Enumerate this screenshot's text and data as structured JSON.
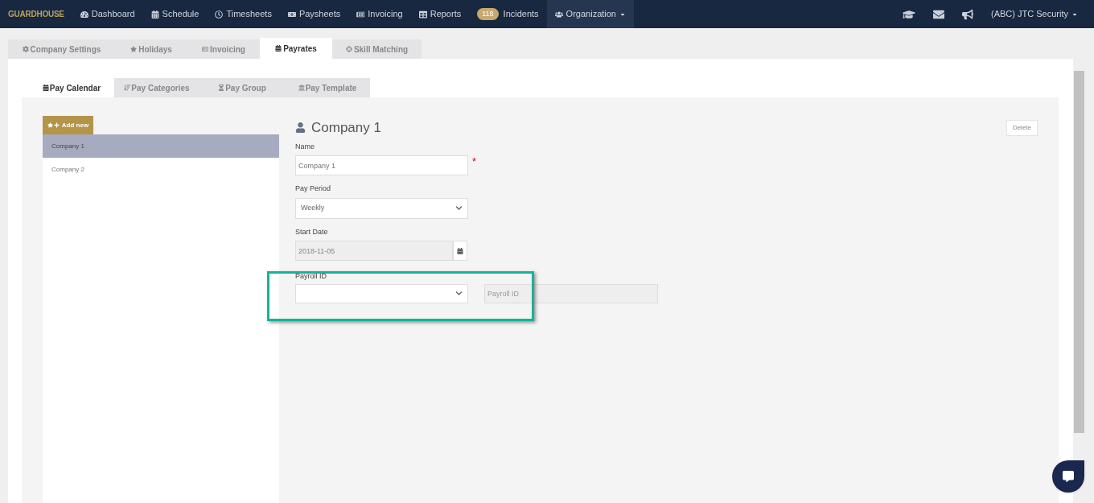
{
  "navbar": {
    "logo": "GUARDHOUSE",
    "items": [
      {
        "label": "Dashboard",
        "kind": "link",
        "selected": false
      },
      {
        "label": "Schedule",
        "kind": "link",
        "selected": false
      },
      {
        "label": "Timesheets",
        "kind": "link",
        "selected": false
      },
      {
        "label": "Paysheets",
        "kind": "link",
        "selected": false
      },
      {
        "label": "Invoicing",
        "kind": "link",
        "selected": false
      },
      {
        "label": "Reports",
        "kind": "link",
        "selected": false
      },
      {
        "label": "Incidents",
        "kind": "link",
        "badge": "118",
        "selected": false
      },
      {
        "label": "Organization",
        "kind": "dropdown",
        "selected": true
      }
    ],
    "account": "(ABC) JTC Security"
  },
  "tabs": [
    {
      "label": "Company Settings",
      "selected": false
    },
    {
      "label": "Holidays",
      "selected": false
    },
    {
      "label": "Invoicing",
      "selected": false
    },
    {
      "label": "Payrates",
      "selected": true
    },
    {
      "label": "Skill Matching",
      "selected": false
    }
  ],
  "subtabs": [
    {
      "label": "Pay Calendar",
      "selected": true
    },
    {
      "label": "Pay Categories",
      "selected": false
    },
    {
      "label": "Pay Group",
      "selected": false
    },
    {
      "label": "Pay Template",
      "selected": false
    }
  ],
  "add_button": "Add new",
  "companies": [
    {
      "name": "Company 1",
      "selected": true
    },
    {
      "name": "Company 2",
      "selected": false
    }
  ],
  "form": {
    "title": "Company 1",
    "delete": "Delete",
    "name": {
      "label": "Name",
      "value": "Company 1",
      "required_mark": "*"
    },
    "pay_period": {
      "label": "Pay Period",
      "value": "Weekly"
    },
    "start_date": {
      "label": "Start Date",
      "value": "2018-11-05"
    },
    "payroll_id": {
      "label": "Payroll ID",
      "placeholder": "Payroll ID"
    }
  }
}
